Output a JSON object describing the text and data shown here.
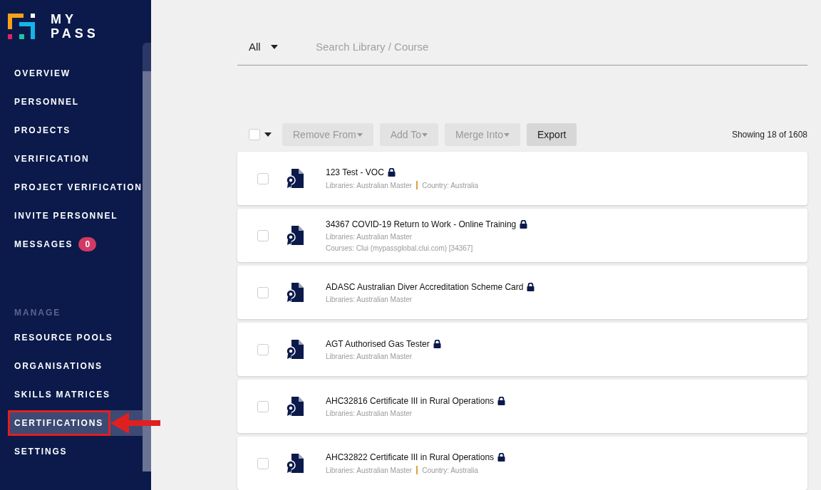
{
  "brand": {
    "line1": "MY",
    "line2": "PASS"
  },
  "nav": [
    {
      "label": "OVERVIEW",
      "selected": false
    },
    {
      "label": "PERSONNEL",
      "selected": false
    },
    {
      "label": "PROJECTS",
      "selected": false
    },
    {
      "label": "VERIFICATION",
      "selected": false
    },
    {
      "label": "PROJECT VERIFICATION",
      "selected": false
    },
    {
      "label": "INVITE PERSONNEL",
      "selected": false
    },
    {
      "label": "MESSAGES",
      "selected": false,
      "badge": "0"
    }
  ],
  "manage_heading": "MANAGE",
  "manage_nav": [
    {
      "label": "RESOURCE POOLS",
      "selected": false
    },
    {
      "label": "ORGANISATIONS",
      "selected": false
    },
    {
      "label": "SKILLS MATRICES",
      "selected": false
    },
    {
      "label": "CERTIFICATIONS",
      "selected": true
    },
    {
      "label": "SETTINGS",
      "selected": false
    }
  ],
  "filter": {
    "scope": "All",
    "placeholder": "Search Library / Course"
  },
  "toolbar": {
    "select_all_checked": false,
    "buttons": [
      {
        "label": "Remove From",
        "disabled": true
      },
      {
        "label": "Add To",
        "disabled": true
      },
      {
        "label": "Merge Into",
        "disabled": true
      },
      {
        "label": "Export",
        "disabled": false
      }
    ],
    "count": "Showing 18 of 1608"
  },
  "certifications": [
    {
      "title": "123 Test - VOC",
      "locked": true,
      "checked": false,
      "meta": [
        [
          "Libraries: Australian Master",
          "Country: Australia"
        ]
      ]
    },
    {
      "title": "34367 COVID-19 Return to Work - Online Training",
      "locked": true,
      "checked": false,
      "meta": [
        [
          "Libraries: Australian Master"
        ],
        [
          "Courses: Clui (mypassglobal.clui.com) [34367]"
        ]
      ]
    },
    {
      "title": "ADASC Australian Diver Accreditation Scheme Card",
      "locked": true,
      "checked": false,
      "meta": [
        [
          "Libraries: Australian Master"
        ]
      ]
    },
    {
      "title": "AGT Authorised Gas Tester",
      "locked": true,
      "checked": false,
      "meta": [
        [
          "Libraries: Australian Master"
        ]
      ]
    },
    {
      "title": "AHC32816 Certificate III in Rural Operations",
      "locked": true,
      "checked": false,
      "meta": [
        [
          "Libraries: Australian Master"
        ]
      ]
    },
    {
      "title": "AHC32822 Certificate III in Rural Operations",
      "locked": true,
      "checked": false,
      "meta": [
        [
          "Libraries: Australian Master",
          "Country: Australia"
        ]
      ]
    }
  ]
}
